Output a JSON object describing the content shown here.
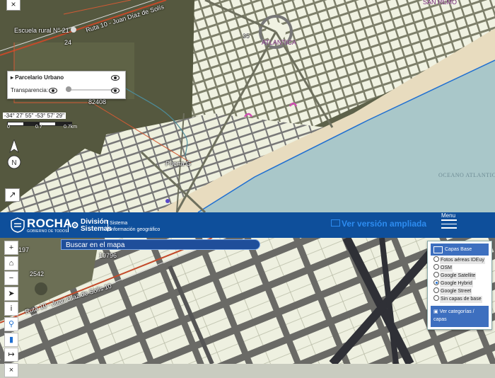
{
  "top_map": {
    "labels": {
      "escuela": "Escuela rural N° 21",
      "ruta": "Ruta 10 - Juan Díaz de Solís",
      "atlantida": "ATLANTICA",
      "san_remo": "SAN REMO",
      "oceano": "OCEANO ATLANTICO",
      "puerta": "Puerta G",
      "lot_24": "24",
      "lot_82": "82408",
      "lot_35": "35"
    },
    "close_label": "×",
    "layer_panel": {
      "title": "Parcelario Urbano",
      "transparency_label": "Transparencia:",
      "transparency_level": 0
    },
    "coords": "-34° 27' 55\" -53° 57' 29\"",
    "scale": {
      "start": "0",
      "mid": "0.7",
      "end": "0.7km"
    },
    "expand_icon": "↗"
  },
  "header": {
    "brand": "ROCHA",
    "brand_sub": "GOBIERNO DE TODOS",
    "division_line1": "División",
    "division_line2": "Sistemas",
    "sistema_line1": "Sistema",
    "sistema_line2": "Información geográfico",
    "ampliada": "Ver versión ampliada",
    "menu_label": "Menu"
  },
  "bottom_map": {
    "labels": {
      "l197": "197",
      "l2542": "2542",
      "l10796": "10796",
      "ruta": "Ruta 10 - Juan Díaz de Solís 10"
    },
    "toolbar": [
      "+",
      "⌂",
      "−",
      "➤",
      "i",
      "⚲",
      "▮",
      "↦",
      "×"
    ],
    "search_placeholder": "Buscar en el mapa",
    "base_panel": {
      "title": "Capas Base",
      "options": [
        "Fotos aéreas IDEuy",
        "OSM",
        "Google Satellite",
        "Google Hybrid",
        "Google Street",
        "Sin capas de base"
      ],
      "selected": "Google Hybrid",
      "categories_label": "Ver categorías / capas"
    }
  },
  "colors": {
    "header_blue": "#0e4f9b",
    "accent_blue": "#2d8cf0",
    "panel_blue": "#3d6fbf",
    "sea": "#a9c7c9",
    "beach": "#e6dcc1",
    "parcel": "#e8ecd8"
  }
}
